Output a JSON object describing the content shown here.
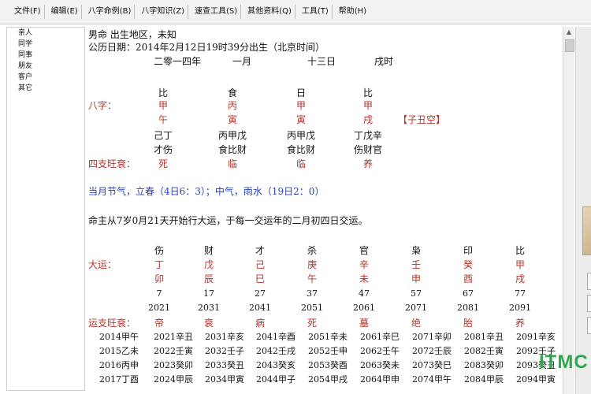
{
  "menu": [
    "文件(F)",
    "编辑(E)",
    "八字命例(B)",
    "八字知识(Z)",
    "速查工具(S)",
    "其他资料(Q)",
    "工具(T)",
    "帮助(H)"
  ],
  "sidebar": [
    "亲人",
    "同学",
    "同事",
    "朋友",
    "客户",
    "其它"
  ],
  "header": {
    "line1": "男命     出生地区，未知",
    "line2": "公历日期：2014年2月12日19时39分出生（北京时间）",
    "lunar": [
      "二零一四年",
      "一月",
      "十三日",
      "戌时"
    ]
  },
  "bazi": {
    "label": "八字：",
    "shishen": [
      "比",
      "食",
      "日",
      "比"
    ],
    "gan": [
      "甲",
      "丙",
      "甲",
      "甲"
    ],
    "zhi": [
      "午",
      "寅",
      "寅",
      "戌"
    ],
    "kong": "【子丑空】",
    "canggan": [
      "己丁",
      "丙甲戊",
      "丙甲戊",
      "丁戊辛"
    ],
    "cangshen": [
      "才伤",
      "食比财",
      "食比财",
      "伤财官"
    ],
    "wang_label": "四支旺衰：",
    "wang": [
      "死",
      "临",
      "临",
      "养"
    ]
  },
  "jieqi": "当月节气，立春（4日6：3）；中气，雨水（19日2：0）",
  "dayun_intro": "命主从7岁0月21天开始行大运，于每一交运年的二月初四日交运。",
  "dayun": {
    "label": "大运：",
    "shishen": [
      "伤",
      "财",
      "才",
      "杀",
      "官",
      "枭",
      "印",
      "比"
    ],
    "gan": [
      "丁",
      "戊",
      "己",
      "庚",
      "辛",
      "壬",
      "癸",
      "甲"
    ],
    "zhi": [
      "卯",
      "辰",
      "巳",
      "午",
      "未",
      "申",
      "酉",
      "戌"
    ],
    "ages": [
      "7",
      "17",
      "27",
      "37",
      "47",
      "57",
      "67",
      "77"
    ],
    "years": [
      "2021",
      "2031",
      "2041",
      "2051",
      "2061",
      "2071",
      "2081",
      "2091"
    ],
    "wang_label": "运支旺衰：",
    "wang": [
      "帝",
      "衰",
      "病",
      "死",
      "墓",
      "绝",
      "胎",
      "养"
    ]
  },
  "liunian": [
    [
      "2014甲午",
      "2021辛丑",
      "2031辛亥",
      "2041辛酉",
      "2051辛未",
      "2061辛巳",
      "2071辛卯",
      "2081辛丑",
      "2091辛亥"
    ],
    [
      "2015乙未",
      "2022壬寅",
      "2032壬子",
      "2042壬戌",
      "2052壬申",
      "2062壬午",
      "2072壬辰",
      "2082壬寅",
      "2092壬子"
    ],
    [
      "2016丙申",
      "2023癸卯",
      "2033癸丑",
      "2043癸亥",
      "2053癸酉",
      "2063癸未",
      "2073癸巳",
      "2083癸卯",
      "2093癸丑"
    ],
    [
      "2017丁酉",
      "2024甲辰",
      "2034甲寅",
      "2044甲子",
      "2054甲戌",
      "2064甲申",
      "2074甲午",
      "2084甲辰",
      "2094甲寅"
    ]
  ],
  "watermark": "ITMC",
  "colors": {
    "red": "#b5352e",
    "blue": "#2b3fb2",
    "watermark": "#2fa84f"
  }
}
